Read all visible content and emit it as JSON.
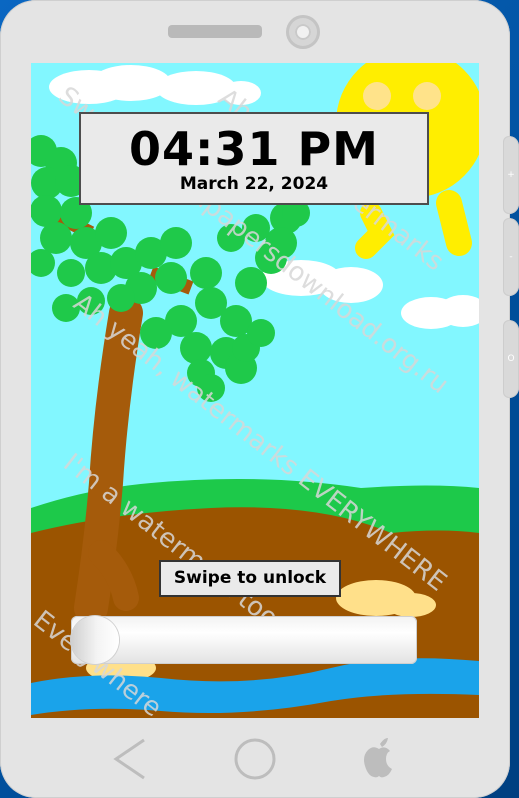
{
  "lock_screen": {
    "time": "04:31 PM",
    "date": "March 22, 2024",
    "unlock_label": "Swipe to unlock",
    "unlock_progress": 0
  },
  "watermarks": [
    "Sweet",
    "wallpapersdownload.org.ru",
    "Ah yeah, watermarks",
    "Ah yeah, watermarks EVERYWHERE",
    "I'm a watermark too",
    "Everywhere",
    "Ah yeah, watermarks"
  ],
  "side_buttons": {
    "volume_up": "+",
    "volume_down": "-",
    "power": "O"
  },
  "nav_bar": {
    "back": "back-arrow-icon",
    "home": "home-circle-icon",
    "brand": "apple-logo-icon"
  },
  "colors": {
    "sky": "#82f7ff",
    "sun": "#ffe800",
    "grass": "#1dc94a",
    "ground": "#9b5400",
    "river": "#1aa3ea",
    "tree_leaves": "#1fc94a",
    "tree_trunk": "#a55b0b",
    "phone_body": "#e4e4e4"
  }
}
